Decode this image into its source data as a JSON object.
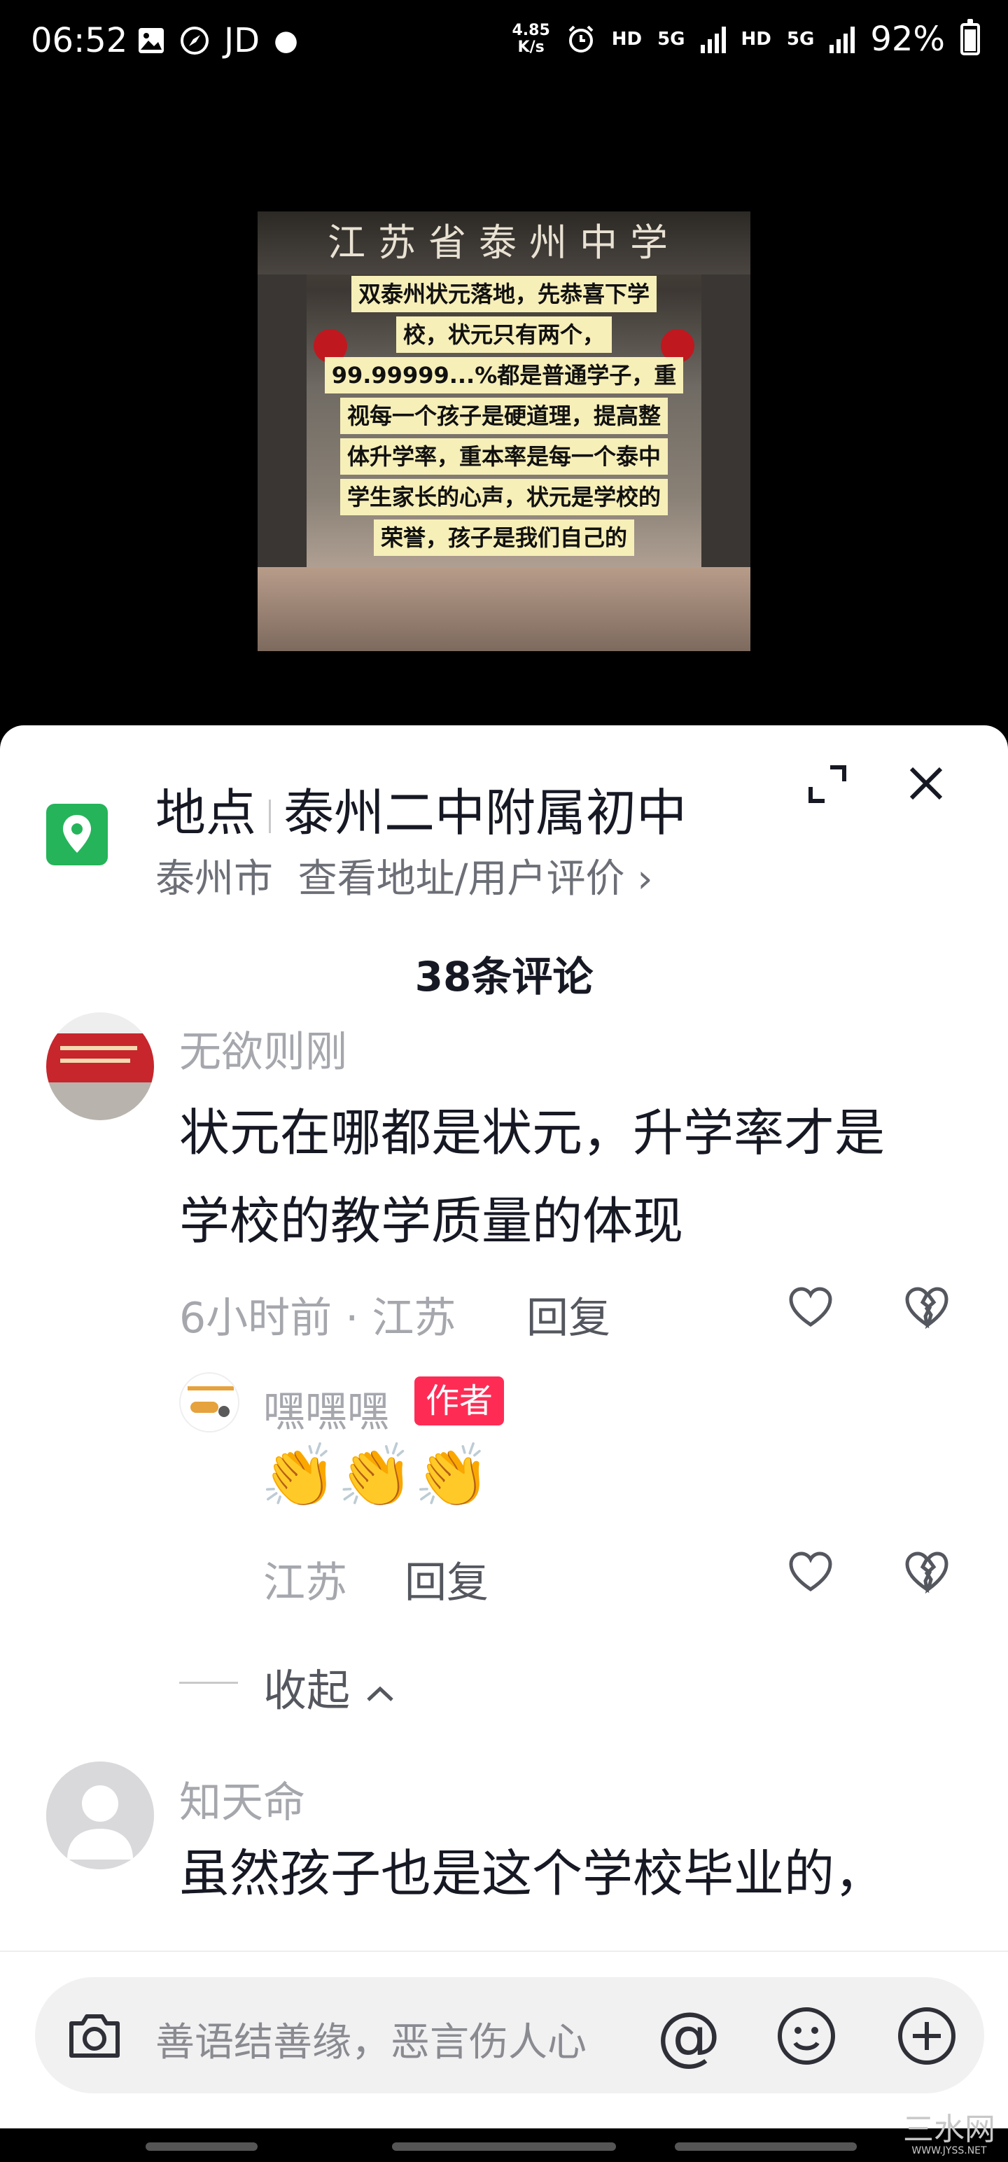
{
  "status": {
    "time": "06:52",
    "carrier": "JD",
    "speed_top": "4.85",
    "speed_bottom": "K/s",
    "hd1": "HD",
    "net1": "5G",
    "hd2": "HD",
    "net2": "5G",
    "battery": "92%",
    "battery_level": 0.92
  },
  "video": {
    "gate_text": "江苏省泰州中学",
    "caption_lines": [
      "双泰州状元落地，先恭喜下学",
      "校，状元只有两个，",
      "99.99999...%都是普通学子，重",
      "视每一个孩子是硬道理，提高整",
      "体升学率，重本率是每一个泰中",
      "学生家长的心声，状元是学校的",
      "荣誉，孩子是我们自己的"
    ]
  },
  "location": {
    "label": "地点",
    "place": "泰州二中附属初中",
    "city": "泰州市",
    "link": "查看地址/用户评价 ›"
  },
  "comments_count": "38条评论",
  "comments": [
    {
      "user": "无欲则刚",
      "text_line1": "状元在哪都是状元，升学率才是",
      "text_line2": "学校的教学质量的体现",
      "meta": "6小时前 · 江苏",
      "reply": "回复"
    },
    {
      "user": "知天命",
      "text_line1": "虽然孩子也是这个学校毕业的，"
    }
  ],
  "sub_reply": {
    "user": "嘿嘿嘿",
    "badge": "作者",
    "emoji": "👏👏👏",
    "meta": "江苏",
    "reply": "回复"
  },
  "collapse_label": "收起",
  "input": {
    "placeholder": "善语结善缘，恶言伤人心",
    "at": "@"
  },
  "watermark": {
    "title": "三水网",
    "url": "WWW.JYSS.NET"
  },
  "colors": {
    "accent": "#fe2c55",
    "location_green": "#25b45a"
  }
}
